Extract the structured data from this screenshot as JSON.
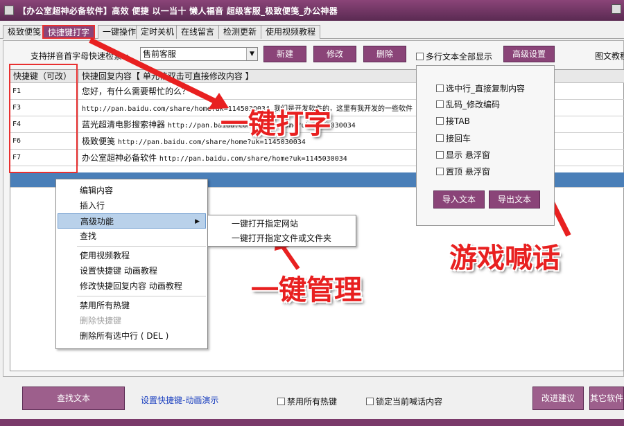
{
  "title": {
    "text": "【办公室超神必备软件】高效    便捷    以一当十    懒人福音    超级客服_极致便笺_办公神器"
  },
  "tabs": [
    {
      "label": "极致便笺"
    },
    {
      "label": "快捷键打字"
    },
    {
      "label": "一键操作"
    },
    {
      "label": "定时关机"
    },
    {
      "label": "在线留言"
    },
    {
      "label": "检测更新"
    },
    {
      "label": "使用视频教程"
    }
  ],
  "toolbar": {
    "search_label": "支持拼音首字母快速检索→",
    "category_value": "售前客服",
    "new_label": "新建",
    "edit_label": "修改",
    "delete_label": "删除",
    "multiline_label": "多行文本全部显示",
    "advanced_label": "高级设置",
    "image_text_label": "图文教程"
  },
  "table": {
    "col_hotkey": "快捷键（可改）",
    "col_content": "快捷回复内容【  单元格双击可直接修改内容  】",
    "rows": [
      {
        "key": "F1",
        "text": "您好，有什么需要帮忙的么？",
        "url": ""
      },
      {
        "key": "F3",
        "text": "",
        "url": "http://pan.baidu.com/share/home?uk=1145030034  我们是开发软件的，这里有我开发的一些软件"
      },
      {
        "key": "F4",
        "text": "蓝光超清电影搜索神器",
        "url": "http://pan.baidu.com/share/home?uk=1145030034"
      },
      {
        "key": "F6",
        "text": "极致便笺",
        "url": "http://pan.baidu.com/share/home?uk=1145030034"
      },
      {
        "key": "F7",
        "text": "办公室超神必备软件",
        "url": "http://pan.baidu.com/share/home?uk=1145030034"
      }
    ]
  },
  "context_menu": {
    "edit": "编辑内容",
    "insert_row": "插入行",
    "advanced": "高级功能",
    "find": "查找",
    "video": "使用视频教程",
    "set_hotkey_anim": "设置快捷键 动画教程",
    "edit_reply_anim": "修改快捷回复内容 动画教程",
    "disable_all": "禁用所有热键",
    "delete_hotkey": "删除快捷键",
    "delete_selected": "删除所有选中行 ( DEL )"
  },
  "submenu": {
    "open_site": "一键打开指定网站",
    "open_file": "一键打开指定文件或文件夹"
  },
  "settings": {
    "opt_copy": "选中行_直接复制内容",
    "opt_garbled": "乱码_修改编码",
    "opt_tab": "接TAB",
    "opt_enter": "接回车",
    "opt_float_show": "显示 悬浮窗",
    "opt_float_top": "置顶 悬浮窗",
    "import_label": "导入文本",
    "export_label": "导出文本"
  },
  "annotations": {
    "typing": "一键打字",
    "manage": "一键管理",
    "game": "游戏喊话"
  },
  "bottom": {
    "find_text_label": "查找文本",
    "hotkey_demo_link": "设置快捷键-动画演示",
    "disable_hotkeys_label": "禁用所有热键",
    "lock_label": "锁定当前喊话内容",
    "suggest_label": "改进建议",
    "other_label": "其它软件"
  },
  "colors": {
    "brand": "#8a4478",
    "annotation_red": "#e82020",
    "selection_blue": "#4a7fb8"
  }
}
